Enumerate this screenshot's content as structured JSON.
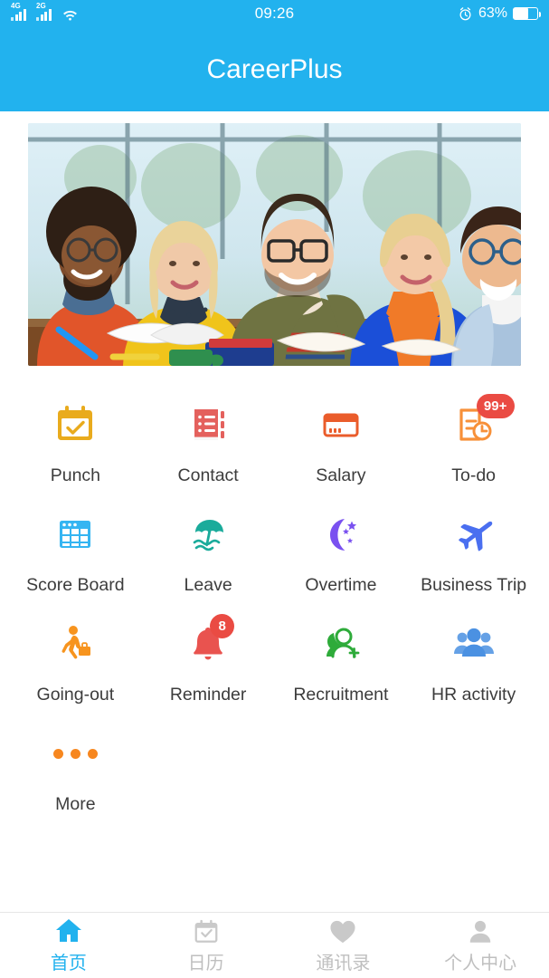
{
  "status_bar": {
    "sim1_network": "4G",
    "sim2_network": "2G",
    "wifi_icon": "wifi-icon",
    "time": "09:26",
    "alarm_icon": "alarm-clock-icon",
    "battery_percent": "63%",
    "battery_level": 63
  },
  "header": {
    "title": "CareerPlus",
    "background_color": "#22b2ee"
  },
  "banner": {
    "alt": "Five smiling colleagues studying together at a table with books",
    "caption": ""
  },
  "grid": {
    "items": [
      {
        "label": "Punch",
        "icon": "calendar-check-icon",
        "color": "#e9ab1d",
        "badge": ""
      },
      {
        "label": "Contact",
        "icon": "address-book-icon",
        "color": "#e4615d",
        "badge": ""
      },
      {
        "label": "Salary",
        "icon": "credit-card-icon",
        "color": "#ea5c2b",
        "badge": ""
      },
      {
        "label": "To-do",
        "icon": "clipboard-clock-icon",
        "color": "#f79039",
        "badge": "99+"
      },
      {
        "label": "Score Board",
        "icon": "table-grid-icon",
        "color": "#35b5f2",
        "badge": ""
      },
      {
        "label": "Leave",
        "icon": "beach-umbrella-icon",
        "color": "#1aab9b",
        "badge": ""
      },
      {
        "label": "Overtime",
        "icon": "moon-stars-icon",
        "color": "#7a51f0",
        "badge": ""
      },
      {
        "label": "Business Trip",
        "icon": "airplane-icon",
        "color": "#4a6ff0",
        "badge": ""
      },
      {
        "label": "Going-out",
        "icon": "walking-traveler-icon",
        "color": "#f7941e",
        "badge": ""
      },
      {
        "label": "Reminder",
        "icon": "bell-icon",
        "color": "#e9534f",
        "badge": "8"
      },
      {
        "label": "Recruitment",
        "icon": "add-person-icon",
        "color": "#2eab3a",
        "badge": ""
      },
      {
        "label": "HR activity",
        "icon": "people-group-icon",
        "color": "#4b91e2",
        "badge": ""
      },
      {
        "label": "More",
        "icon": "more-dots-icon",
        "color": "#f7871f",
        "badge": ""
      }
    ]
  },
  "bottom_nav": {
    "items": [
      {
        "label": "首页",
        "icon": "home-icon",
        "active": true
      },
      {
        "label": "日历",
        "icon": "calendar-icon",
        "active": false
      },
      {
        "label": "通讯录",
        "icon": "heart-icon",
        "active": false
      },
      {
        "label": "个人中心",
        "icon": "person-icon",
        "active": false
      }
    ],
    "active_color": "#22b2ee",
    "inactive_color": "#bfbfbf"
  }
}
